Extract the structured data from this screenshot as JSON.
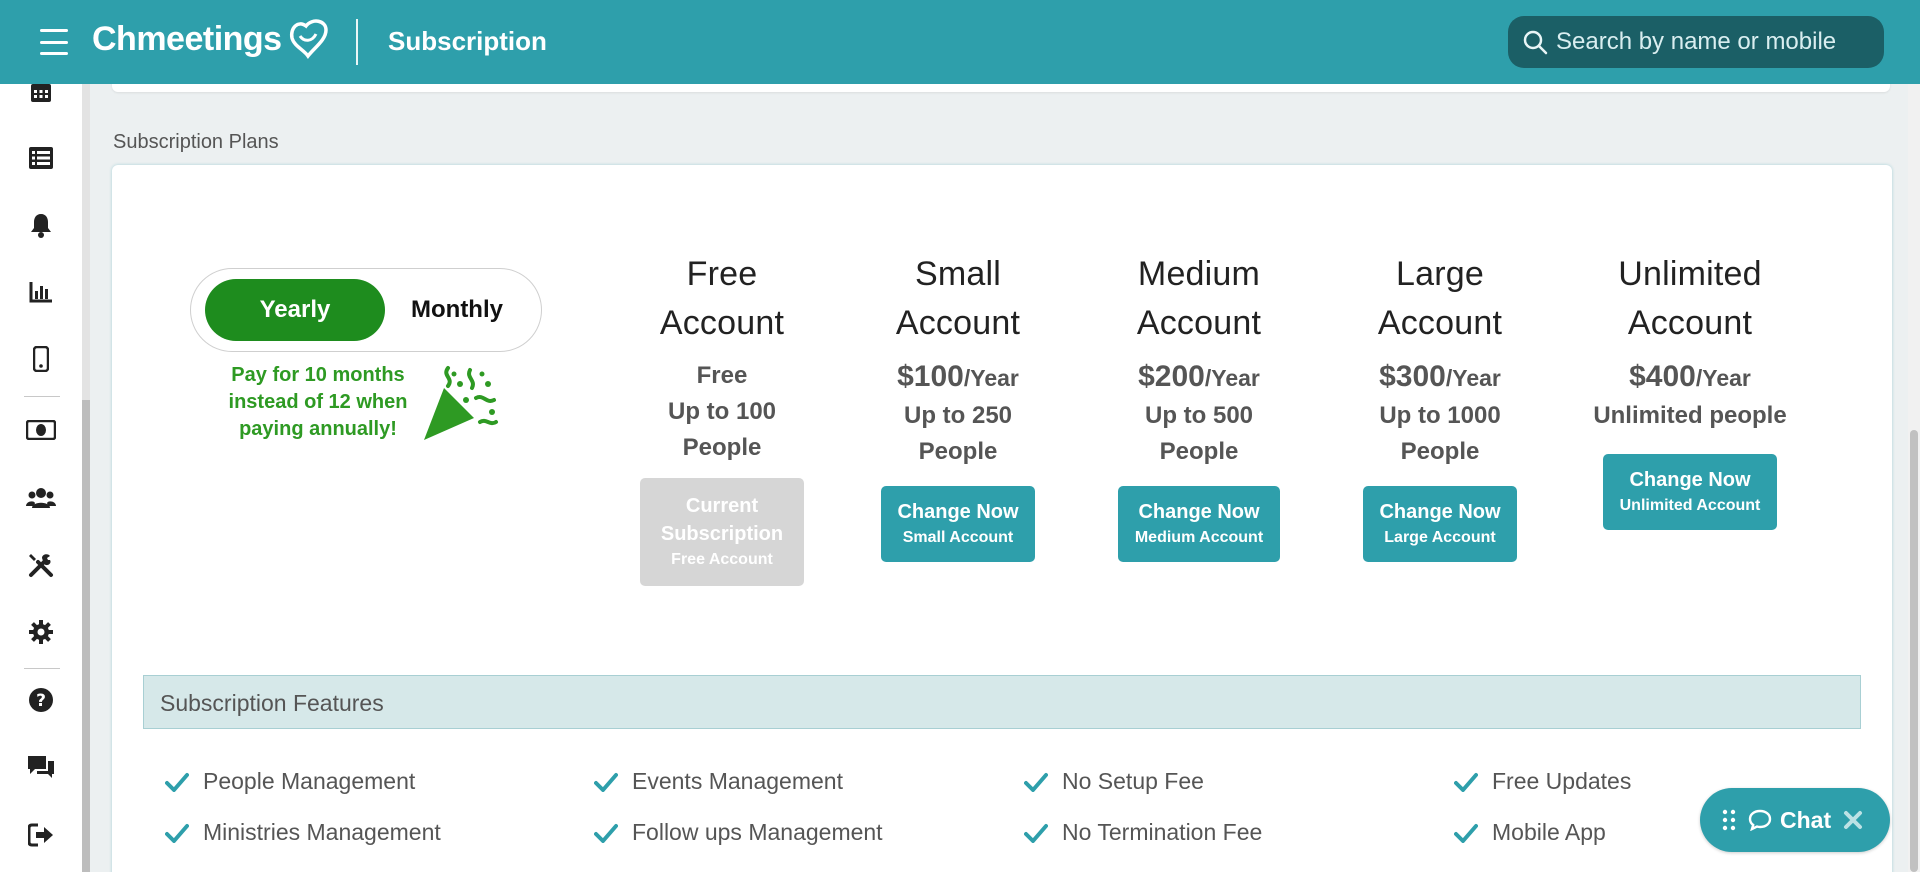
{
  "header": {
    "logo_text": "Chmeetings",
    "page_title": "Subscription",
    "search_placeholder": "Search by name or mobile"
  },
  "sidebar": {
    "icons": [
      "calendar-icon",
      "list-icon",
      "bell-icon",
      "bar-chart-icon",
      "mobile-icon",
      "money-icon",
      "users-icon",
      "tools-icon",
      "gear-icon",
      "help-icon",
      "chat-bubbles-icon",
      "logout-icon"
    ]
  },
  "plans_section": {
    "label": "Subscription Plans",
    "toggle": {
      "yearly": "Yearly",
      "monthly": "Monthly",
      "selected": "Yearly"
    },
    "promo_text": "Pay for 10 months instead of 12 when paying annually!",
    "plans": [
      {
        "name_line1": "Free",
        "name_line2": "Account",
        "price": "Free",
        "price_unit": "",
        "limit_line1": "Up to 100",
        "limit_line2": "People",
        "button_line1": "Current Subscription",
        "button_line2": "Free Account",
        "current": true
      },
      {
        "name_line1": "Small",
        "name_line2": "Account",
        "price": "$100",
        "price_unit": "/Year",
        "limit_line1": "Up to 250",
        "limit_line2": "People",
        "button_line1": "Change Now",
        "button_line2": "Small Account",
        "current": false
      },
      {
        "name_line1": "Medium",
        "name_line2": "Account",
        "price": "$200",
        "price_unit": "/Year",
        "limit_line1": "Up to 500",
        "limit_line2": "People",
        "button_line1": "Change Now",
        "button_line2": "Medium Account",
        "current": false
      },
      {
        "name_line1": "Large",
        "name_line2": "Account",
        "price": "$300",
        "price_unit": "/Year",
        "limit_line1": "Up to 1000",
        "limit_line2": "People",
        "button_line1": "Change Now",
        "button_line2": "Large Account",
        "current": false
      },
      {
        "name_line1": "Unlimited",
        "name_line2": "Account",
        "price": "$400",
        "price_unit": "/Year",
        "limit_line1": "Unlimited people",
        "limit_line2": "",
        "button_line1": "Change Now",
        "button_line2": "Unlimited Account",
        "current": false
      }
    ]
  },
  "features": {
    "title": "Subscription Features",
    "items": [
      "People Management",
      "Events Management",
      "No Setup Fee",
      "Free Updates",
      "Ministries Management",
      "Follow ups Management",
      "No Termination Fee",
      "Mobile App"
    ]
  },
  "chat": {
    "label": "Chat"
  },
  "colors": {
    "brand": "#2e9fab",
    "toggle_active": "#1e8c1e",
    "promo": "#2e9a23"
  }
}
